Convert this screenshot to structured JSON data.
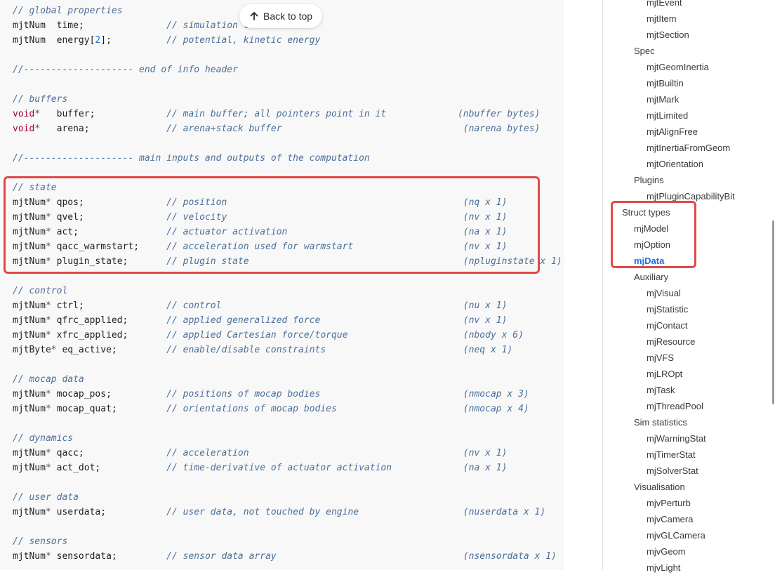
{
  "back_to_top": {
    "label": "Back to top",
    "icon": "arrow-up-icon"
  },
  "code_lines": [
    [
      {
        "t": "com",
        "v": "// global properties"
      }
    ],
    [
      {
        "t": "type",
        "v": "mjtNum"
      },
      {
        "t": "plain",
        "v": "  time;               "
      },
      {
        "t": "com",
        "v": "// simulation time"
      }
    ],
    [
      {
        "t": "type",
        "v": "mjtNum"
      },
      {
        "t": "plain",
        "v": "  energy["
      },
      {
        "t": "num",
        "v": "2"
      },
      {
        "t": "plain",
        "v": "];          "
      },
      {
        "t": "com",
        "v": "// potential, kinetic energy"
      }
    ],
    [],
    [
      {
        "t": "com",
        "v": "//-------------------- end of info header"
      }
    ],
    [],
    [
      {
        "t": "com",
        "v": "// buffers"
      }
    ],
    [
      {
        "t": "kw",
        "v": "void"
      },
      {
        "t": "ptr",
        "v": "*"
      },
      {
        "t": "plain",
        "v": "   buffer;             "
      },
      {
        "t": "com",
        "v": "// main buffer; all pointers point in it             (nbuffer bytes)"
      }
    ],
    [
      {
        "t": "kw",
        "v": "void"
      },
      {
        "t": "ptr",
        "v": "*"
      },
      {
        "t": "plain",
        "v": "   arena;              "
      },
      {
        "t": "com",
        "v": "// arena+stack buffer                                 (narena bytes)"
      }
    ],
    [],
    [
      {
        "t": "com",
        "v": "//-------------------- main inputs and outputs of the computation"
      }
    ],
    [],
    [
      {
        "t": "com",
        "v": "// state"
      }
    ],
    [
      {
        "t": "type",
        "v": "mjtNum"
      },
      {
        "t": "ptr",
        "v": "*"
      },
      {
        "t": "plain",
        "v": " qpos;               "
      },
      {
        "t": "com",
        "v": "// position                                           (nq x 1)"
      }
    ],
    [
      {
        "t": "type",
        "v": "mjtNum"
      },
      {
        "t": "ptr",
        "v": "*"
      },
      {
        "t": "plain",
        "v": " qvel;               "
      },
      {
        "t": "com",
        "v": "// velocity                                           (nv x 1)"
      }
    ],
    [
      {
        "t": "type",
        "v": "mjtNum"
      },
      {
        "t": "ptr",
        "v": "*"
      },
      {
        "t": "plain",
        "v": " act;                "
      },
      {
        "t": "com",
        "v": "// actuator activation                                (na x 1)"
      }
    ],
    [
      {
        "t": "type",
        "v": "mjtNum"
      },
      {
        "t": "ptr",
        "v": "*"
      },
      {
        "t": "plain",
        "v": " qacc_warmstart;     "
      },
      {
        "t": "com",
        "v": "// acceleration used for warmstart                    (nv x 1)"
      }
    ],
    [
      {
        "t": "type",
        "v": "mjtNum"
      },
      {
        "t": "ptr",
        "v": "*"
      },
      {
        "t": "plain",
        "v": " plugin_state;       "
      },
      {
        "t": "com",
        "v": "// plugin state                                       (npluginstate x 1)"
      }
    ],
    [],
    [
      {
        "t": "com",
        "v": "// control"
      }
    ],
    [
      {
        "t": "type",
        "v": "mjtNum"
      },
      {
        "t": "ptr",
        "v": "*"
      },
      {
        "t": "plain",
        "v": " ctrl;               "
      },
      {
        "t": "com",
        "v": "// control                                            (nu x 1)"
      }
    ],
    [
      {
        "t": "type",
        "v": "mjtNum"
      },
      {
        "t": "ptr",
        "v": "*"
      },
      {
        "t": "plain",
        "v": " qfrc_applied;       "
      },
      {
        "t": "com",
        "v": "// applied generalized force                          (nv x 1)"
      }
    ],
    [
      {
        "t": "type",
        "v": "mjtNum"
      },
      {
        "t": "ptr",
        "v": "*"
      },
      {
        "t": "plain",
        "v": " xfrc_applied;       "
      },
      {
        "t": "com",
        "v": "// applied Cartesian force/torque                     (nbody x 6)"
      }
    ],
    [
      {
        "t": "type",
        "v": "mjtByte"
      },
      {
        "t": "ptr",
        "v": "*"
      },
      {
        "t": "plain",
        "v": " eq_active;         "
      },
      {
        "t": "com",
        "v": "// enable/disable constraints                         (neq x 1)"
      }
    ],
    [],
    [
      {
        "t": "com",
        "v": "// mocap data"
      }
    ],
    [
      {
        "t": "type",
        "v": "mjtNum"
      },
      {
        "t": "ptr",
        "v": "*"
      },
      {
        "t": "plain",
        "v": " mocap_pos;          "
      },
      {
        "t": "com",
        "v": "// positions of mocap bodies                          (nmocap x 3)"
      }
    ],
    [
      {
        "t": "type",
        "v": "mjtNum"
      },
      {
        "t": "ptr",
        "v": "*"
      },
      {
        "t": "plain",
        "v": " mocap_quat;         "
      },
      {
        "t": "com",
        "v": "// orientations of mocap bodies                       (nmocap x 4)"
      }
    ],
    [],
    [
      {
        "t": "com",
        "v": "// dynamics"
      }
    ],
    [
      {
        "t": "type",
        "v": "mjtNum"
      },
      {
        "t": "ptr",
        "v": "*"
      },
      {
        "t": "plain",
        "v": " qacc;               "
      },
      {
        "t": "com",
        "v": "// acceleration                                       (nv x 1)"
      }
    ],
    [
      {
        "t": "type",
        "v": "mjtNum"
      },
      {
        "t": "ptr",
        "v": "*"
      },
      {
        "t": "plain",
        "v": " act_dot;            "
      },
      {
        "t": "com",
        "v": "// time-derivative of actuator activation             (na x 1)"
      }
    ],
    [],
    [
      {
        "t": "com",
        "v": "// user data"
      }
    ],
    [
      {
        "t": "type",
        "v": "mjtNum"
      },
      {
        "t": "ptr",
        "v": "*"
      },
      {
        "t": "plain",
        "v": " userdata;           "
      },
      {
        "t": "com",
        "v": "// user data, not touched by engine                   (nuserdata x 1)"
      }
    ],
    [],
    [
      {
        "t": "com",
        "v": "// sensors"
      }
    ],
    [
      {
        "t": "type",
        "v": "mjtNum"
      },
      {
        "t": "ptr",
        "v": "*"
      },
      {
        "t": "plain",
        "v": " sensordata;         "
      },
      {
        "t": "com",
        "v": "// sensor data array                                  (nsensordata x 1)"
      }
    ]
  ],
  "sidebar": {
    "items": [
      {
        "label": "mjtEvent",
        "level": 2
      },
      {
        "label": "mjtItem",
        "level": 2
      },
      {
        "label": "mjtSection",
        "level": 2
      },
      {
        "label": "Spec",
        "level": 1
      },
      {
        "label": "mjtGeomInertia",
        "level": 2
      },
      {
        "label": "mjtBuiltin",
        "level": 2
      },
      {
        "label": "mjtMark",
        "level": 2
      },
      {
        "label": "mjtLimited",
        "level": 2
      },
      {
        "label": "mjtAlignFree",
        "level": 2
      },
      {
        "label": "mjtInertiaFromGeom",
        "level": 2
      },
      {
        "label": "mjtOrientation",
        "level": 2
      },
      {
        "label": "Plugins",
        "level": 1
      },
      {
        "label": "mjtPluginCapabilityBit",
        "level": 2
      },
      {
        "label": "Struct types",
        "level": 0
      },
      {
        "label": "mjModel",
        "level": 1
      },
      {
        "label": "mjOption",
        "level": 1
      },
      {
        "label": "mjData",
        "level": 1,
        "active": true
      },
      {
        "label": "Auxiliary",
        "level": 1
      },
      {
        "label": "mjVisual",
        "level": 2
      },
      {
        "label": "mjStatistic",
        "level": 2
      },
      {
        "label": "mjContact",
        "level": 2
      },
      {
        "label": "mjResource",
        "level": 2
      },
      {
        "label": "mjVFS",
        "level": 2
      },
      {
        "label": "mjLROpt",
        "level": 2
      },
      {
        "label": "mjTask",
        "level": 2
      },
      {
        "label": "mjThreadPool",
        "level": 2
      },
      {
        "label": "Sim statistics",
        "level": 1
      },
      {
        "label": "mjWarningStat",
        "level": 2
      },
      {
        "label": "mjTimerStat",
        "level": 2
      },
      {
        "label": "mjSolverStat",
        "level": 2
      },
      {
        "label": "Visualisation",
        "level": 1
      },
      {
        "label": "mjvPerturb",
        "level": 2
      },
      {
        "label": "mjvCamera",
        "level": 2
      },
      {
        "label": "mjvGLCamera",
        "level": 2
      },
      {
        "label": "mjvGeom",
        "level": 2
      },
      {
        "label": "mjvLight",
        "level": 2
      }
    ]
  },
  "colors": {
    "highlight": "#e04848",
    "active_link": "#1a73e8",
    "keyword": "#a3003e",
    "comment": "#4a6f9a"
  }
}
